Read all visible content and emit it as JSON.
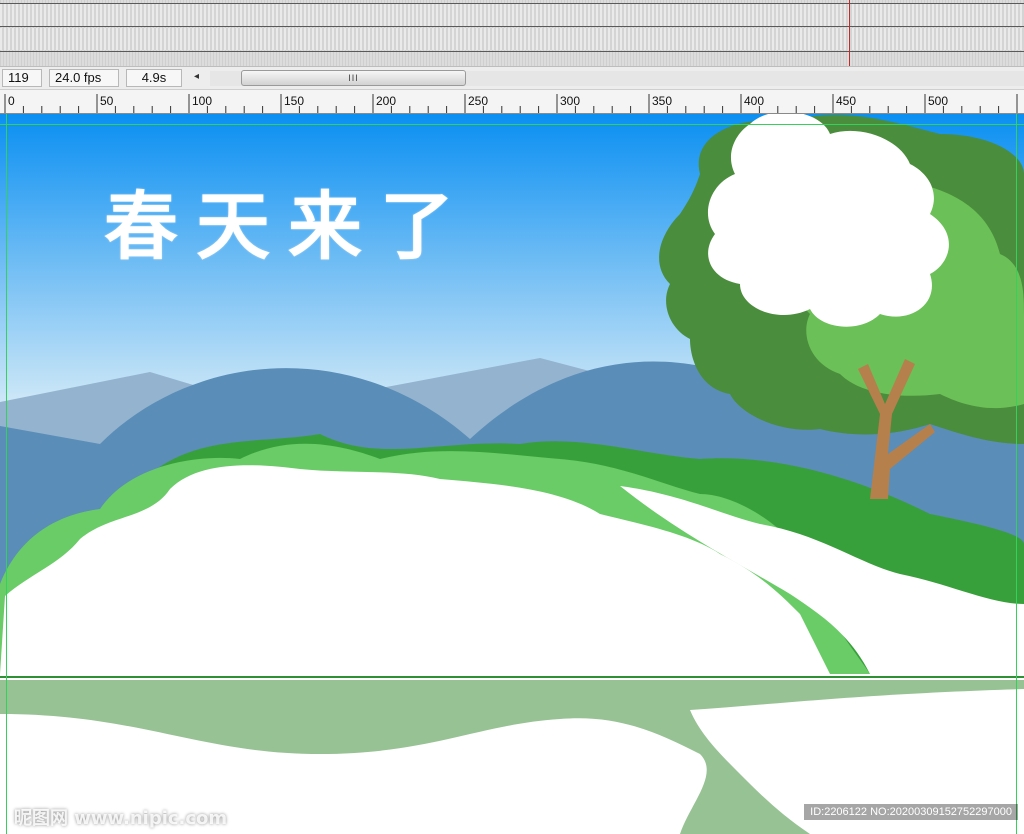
{
  "timeline": {
    "playhead_color": "#c22a2a"
  },
  "status": {
    "frame": "119",
    "fps": "24.0 fps",
    "elapsed": "4.9s",
    "scroll_left_icon": "scroll-left-arrow-icon",
    "thumb_grip": "III"
  },
  "ruler": {
    "ticks": [
      "0",
      "50",
      "100",
      "150",
      "200",
      "250",
      "300",
      "350",
      "400",
      "450",
      "500"
    ]
  },
  "stage": {
    "headline": "春天来了",
    "watermark": "昵图网 www.nipic.com",
    "image_id": "ID:2206122 NO:20200309152752297000",
    "colors": {
      "sky_top": "#0a8ff2",
      "sky_bottom": "#cfe8f7",
      "mountain_far": "#93b3cf",
      "mountain_near": "#5a8db7",
      "bush_light": "#69cc66",
      "bush_dark": "#38a03a",
      "tree_dark": "#4a8d3c",
      "trunk": "#b5804c",
      "ground": "#97c294",
      "guide": "#34d25a"
    }
  }
}
